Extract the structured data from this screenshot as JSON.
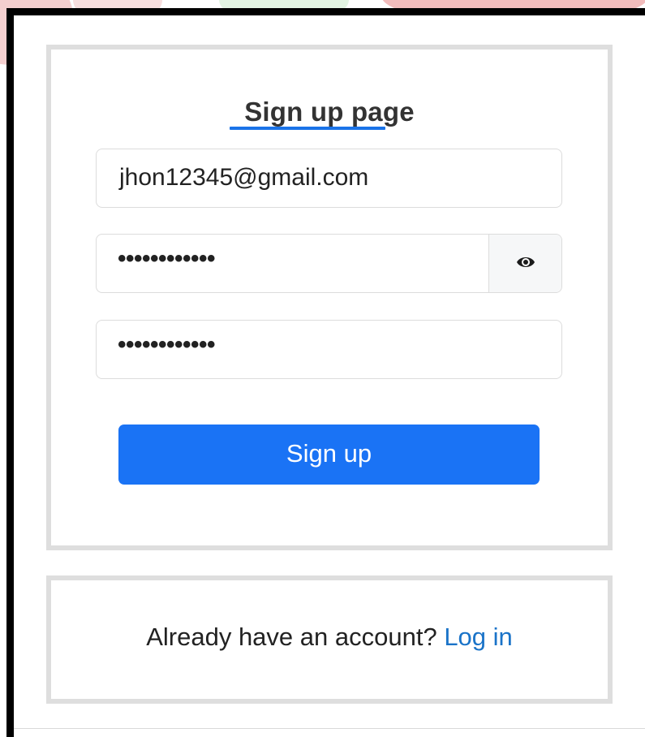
{
  "signup": {
    "title": "Sign up page",
    "email_value": "jhon12345@gmail.com",
    "password_value": "••••••••••••",
    "confirm_password_value": "••••••••••••",
    "submit_label": "Sign up"
  },
  "login_prompt": {
    "text": "Already have an account?",
    "link_label": "Log in"
  },
  "icons": {
    "toggle_password": "eye-icon"
  },
  "colors": {
    "accent": "#1a73f5",
    "link": "#1a73c8",
    "card_border": "#dedede"
  }
}
